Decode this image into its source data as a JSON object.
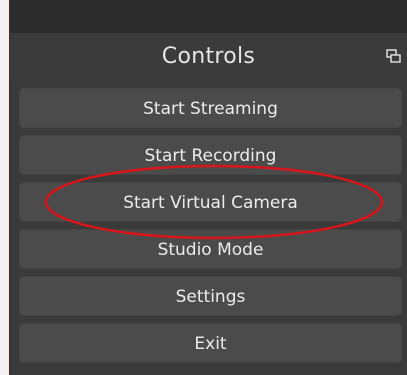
{
  "dock": {
    "title": "Controls",
    "undock_icon": "float-window-icon"
  },
  "buttons": [
    {
      "label": "Start Streaming"
    },
    {
      "label": "Start Recording"
    },
    {
      "label": "Start Virtual Camera"
    },
    {
      "label": "Studio Mode"
    },
    {
      "label": "Settings"
    },
    {
      "label": "Exit"
    }
  ],
  "annotation": {
    "shape": "ellipse",
    "color": "#d9141b",
    "target": "Start Virtual Camera"
  },
  "colors": {
    "dock_background": "#3a3a3a",
    "button_background": "#4b4b4b",
    "text": "#ececec"
  }
}
